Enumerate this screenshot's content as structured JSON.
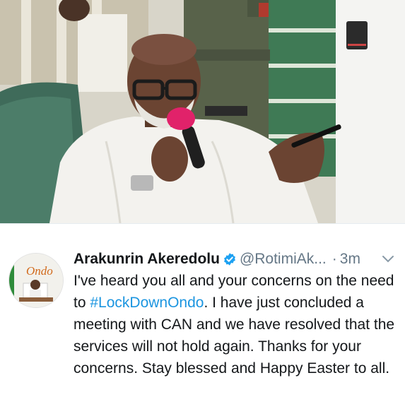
{
  "tweet": {
    "display_name": "Arakunrin Akeredolu",
    "handle": "@RotimiAk...",
    "separator": "·",
    "time": "3m",
    "text_before": "I've heard you all and your concerns on the need to ",
    "hashtag": "#LockDownOndo",
    "text_after": ". I have just concluded a meeting with CAN and we have resolved that the services will not hold again. Thanks for your concerns.  Stay blessed and Happy Easter to all.",
    "avatar_logo_text": "Ondo",
    "verified": true,
    "colors": {
      "link": "#1b95e0",
      "verified": "#1da1f2",
      "secondary_text": "#657786",
      "primary_text": "#14171a"
    }
  },
  "icons": [
    "verified-badge-icon",
    "chevron-down-icon"
  ]
}
